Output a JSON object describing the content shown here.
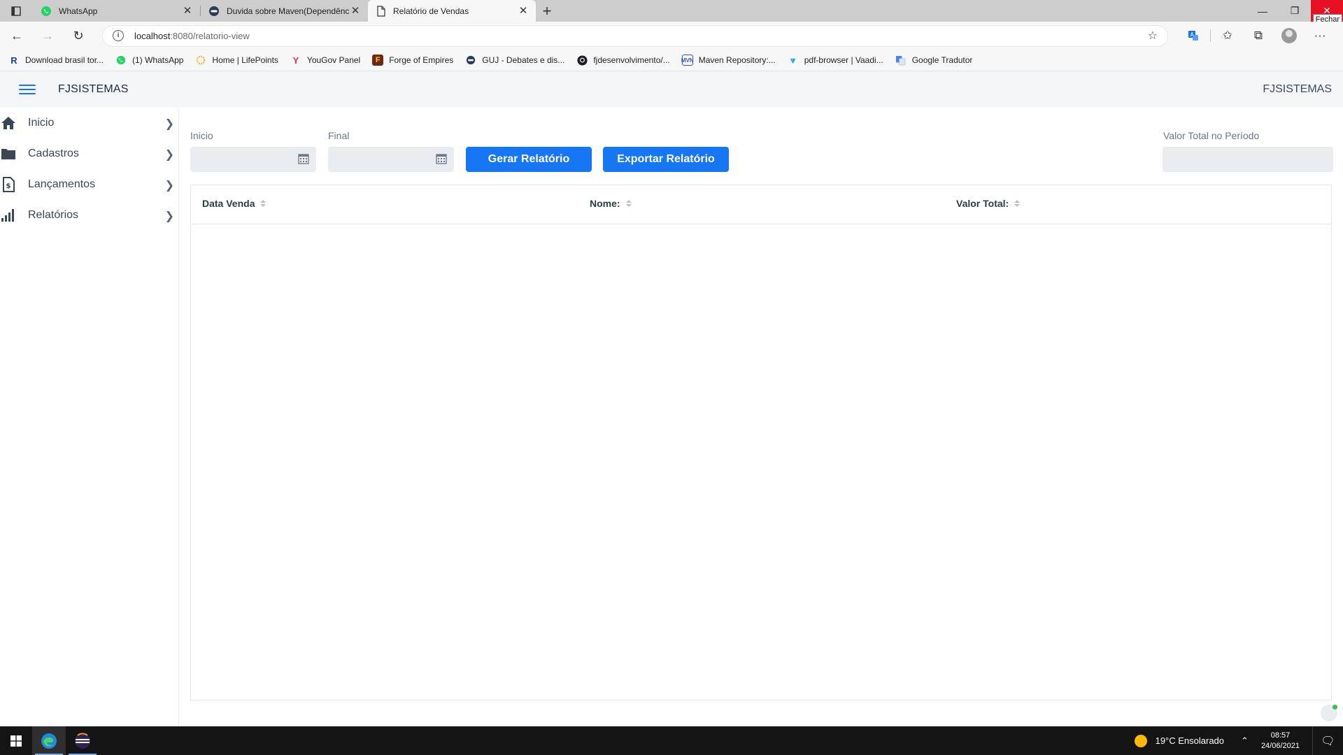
{
  "browser": {
    "tabs": [
      {
        "title": "WhatsApp",
        "icon": "whatsapp-icon",
        "active": false
      },
      {
        "title": "Duvida sobre Maven(Dependência",
        "icon": "guj-icon",
        "active": false
      },
      {
        "title": "Relatório de Vendas",
        "icon": "page-icon",
        "active": true
      }
    ],
    "close_tooltip": "Fechar",
    "url_host": "localhost",
    "url_path": ":8080/relatorio-view",
    "bookmarks": [
      {
        "label": "Download brasil tor...",
        "icon": "R",
        "color": "#1d3fa5"
      },
      {
        "label": "(1) WhatsApp",
        "icon": "wa",
        "color": "#25d366"
      },
      {
        "label": "Home | LifePoints",
        "icon": "lp",
        "color": "#f2b233"
      },
      {
        "label": "YouGov Panel",
        "icon": "Y",
        "color": "#e5315a"
      },
      {
        "label": "Forge of Empires",
        "icon": "F",
        "color": "#6b2b12"
      },
      {
        "label": "GUJ - Debates e dis...",
        "icon": "guj",
        "color": "#2d3b55"
      },
      {
        "label": "fjdesenvolvimento/...",
        "icon": "gh",
        "color": "#1b1f23"
      },
      {
        "label": "Maven Repository:...",
        "icon": "MVN",
        "color": "#2f58b8"
      },
      {
        "label": "pdf-browser | Vaadi...",
        "icon": "v",
        "color": "#00a1e0"
      },
      {
        "label": "Google Tradutor",
        "icon": "G",
        "color": "#4285f4"
      }
    ]
  },
  "app": {
    "brand": "FJSISTEMAS",
    "brand_right": "FJSISTEMAS",
    "sidebar": [
      {
        "label": "Inicio",
        "icon": "home-icon"
      },
      {
        "label": "Cadastros",
        "icon": "folder-icon"
      },
      {
        "label": "Lançamentos",
        "icon": "invoice-icon"
      },
      {
        "label": "Relatórios",
        "icon": "bar-chart-icon"
      }
    ],
    "filters": {
      "start_label": "Inicio",
      "start_value": "",
      "end_label": "Final",
      "end_value": "",
      "generate_button": "Gerar Relatório",
      "export_button": "Exportar Relatório",
      "total_label": "Valor Total no Período",
      "total_value": ""
    },
    "grid": {
      "columns": [
        "Data Venda",
        "Nome:",
        "Valor Total:"
      ],
      "rows": []
    }
  },
  "taskbar": {
    "weather": "19°C  Ensolarado",
    "time": "08:57",
    "date": "24/06/2021"
  },
  "colors": {
    "accent": "#1676f3",
    "header_bg": "#f3f5f7",
    "field_bg": "#e9ecf0"
  }
}
